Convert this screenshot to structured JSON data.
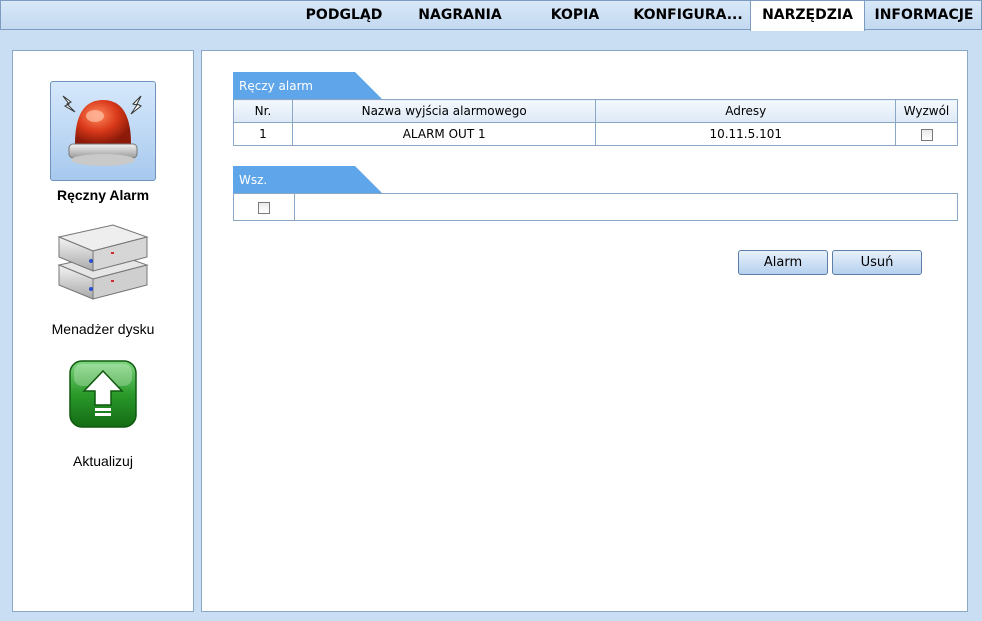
{
  "nav": {
    "tabs": [
      {
        "label": "PODGLĄD"
      },
      {
        "label": "NAGRANIA"
      },
      {
        "label": "KOPIA"
      },
      {
        "label": "KONFIGURA..."
      },
      {
        "label": "NARZĘDZIA",
        "active": true
      },
      {
        "label": "INFORMACJE"
      }
    ]
  },
  "sidebar": {
    "items": [
      {
        "label": "Ręczny Alarm",
        "icon": "alarm-light-icon",
        "active": true
      },
      {
        "label": "Menadżer dysku",
        "icon": "disk-icon"
      },
      {
        "label": "Aktualizuj",
        "icon": "upgrade-arrow-icon"
      }
    ]
  },
  "manual_alarm": {
    "section_title": "Ręczy alarm",
    "columns": [
      "Nr.",
      "Nazwa wyjścia alarmowego",
      "Adresy",
      "Wyzwól"
    ],
    "rows": [
      {
        "nr": "1",
        "name": "ALARM OUT 1",
        "address": "10.11.5.101",
        "trigger": false
      }
    ]
  },
  "all": {
    "section_title": "Wsz.",
    "checked": false
  },
  "buttons": {
    "alarm_label": "Alarm",
    "clear_label": "Usuń"
  },
  "colors": {
    "tab_blue": "#5fa5ea",
    "accent_red": "#d9391a",
    "accent_green": "#2a9a2a"
  }
}
